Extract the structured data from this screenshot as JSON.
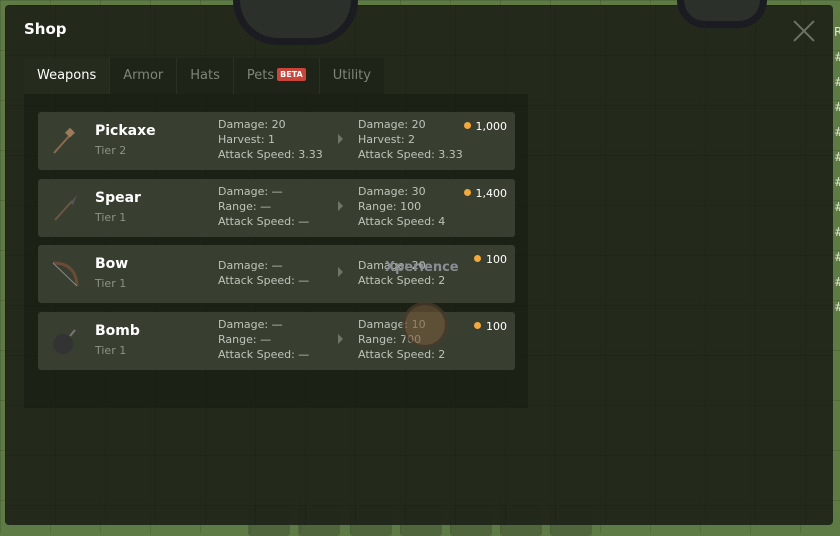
{
  "shop": {
    "title": "Shop",
    "close": "close"
  },
  "tabs": [
    {
      "label": "Weapons",
      "active": true
    },
    {
      "label": "Armor"
    },
    {
      "label": "Hats"
    },
    {
      "label": "Pets",
      "badge": "BETA"
    },
    {
      "label": "Utility"
    }
  ],
  "items": [
    {
      "name": "Pickaxe",
      "tier": "Tier 2",
      "icon": "pickaxe-icon",
      "current": [
        "Damage: 20",
        "Harvest: 1",
        "Attack Speed: 3.33"
      ],
      "next": [
        "Damage: 20",
        "Harvest: 2",
        "Attack Speed: 3.33"
      ],
      "price": "1,000"
    },
    {
      "name": "Spear",
      "tier": "Tier 1",
      "icon": "spear-icon",
      "current": [
        "Damage: —",
        "Range: —",
        "Attack Speed: —"
      ],
      "next": [
        "Damage: 30",
        "Range: 100",
        "Attack Speed: 4"
      ],
      "price": "1,400"
    },
    {
      "name": "Bow",
      "tier": "Tier 1",
      "icon": "bow-icon",
      "current": [
        "Damage: —",
        "Attack Speed: —"
      ],
      "next": [
        "Damage: 20",
        "Attack Speed: 2"
      ],
      "price": "100"
    },
    {
      "name": "Bomb",
      "tier": "Tier 1",
      "icon": "bomb-icon",
      "current": [
        "Damage: —",
        "Range: —",
        "Attack Speed: —"
      ],
      "next": [
        "Damage: 10",
        "Range: 700",
        "Attack Speed: 2"
      ],
      "price": "100"
    }
  ],
  "game": {
    "player_name": "Xperience",
    "leaderboard_header": "R",
    "leaderboard_marks": [
      "#",
      "#",
      "#",
      "#",
      "#",
      "#",
      "#",
      "#",
      "#",
      "#",
      "#"
    ]
  },
  "colors": {
    "coin": "#f4a73b",
    "beta": "#c9443a",
    "grass": "#5f7b45"
  }
}
